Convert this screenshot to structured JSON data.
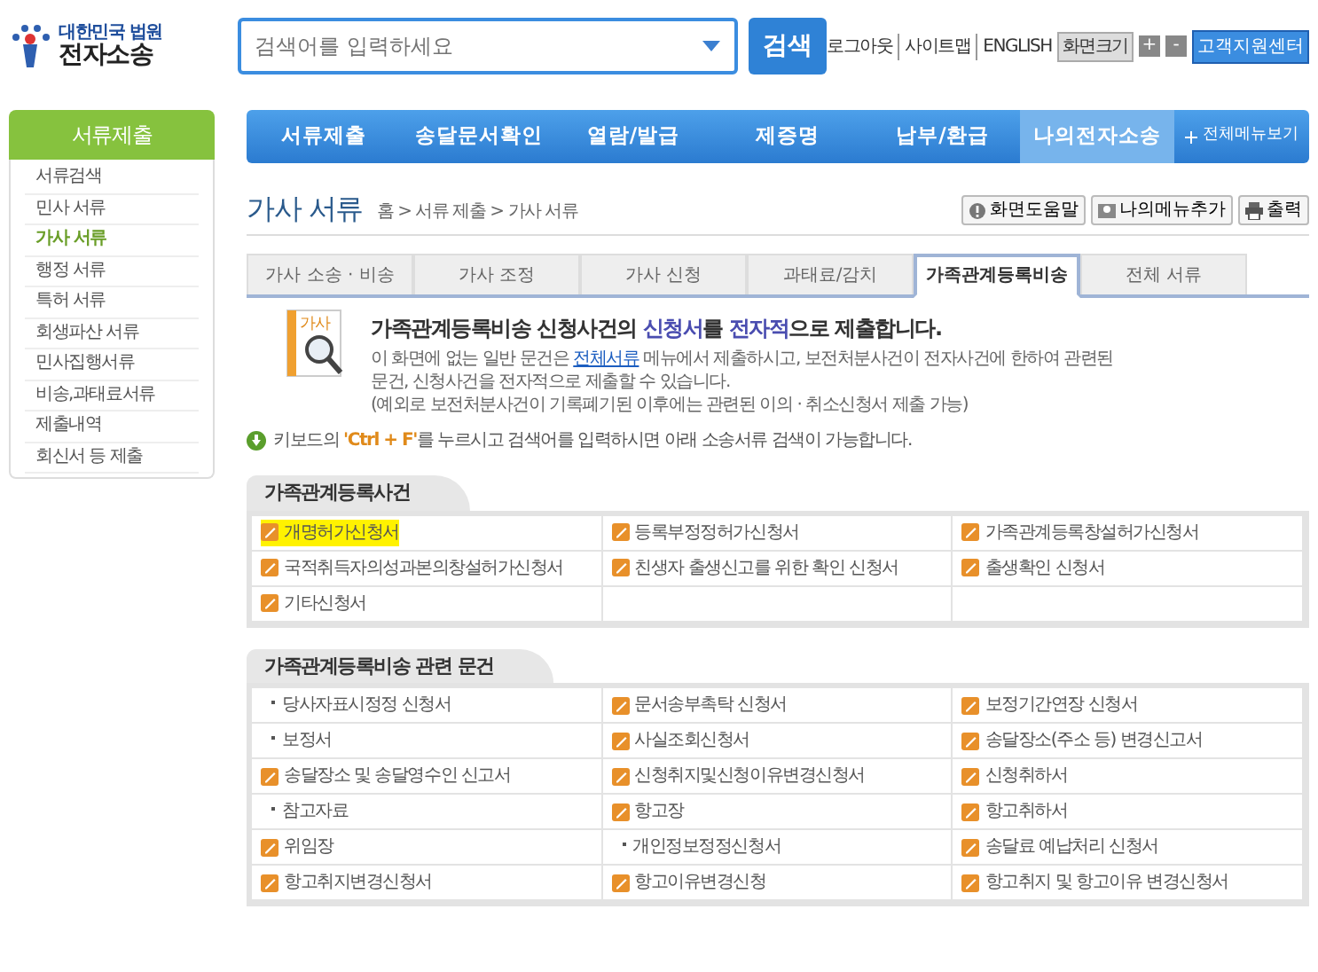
{
  "logo": {
    "subtitle": "대한민국 법원",
    "title": "전자소송"
  },
  "search": {
    "placeholder": "검색어를 입력하세요",
    "button": "검색"
  },
  "top_links": [
    "로그아웃",
    "사이트맵",
    "ENGLISH"
  ],
  "screen_size": {
    "label": "화면크기",
    "buttons": [
      "+",
      "-"
    ]
  },
  "support_button": "고객지원센터",
  "nav": [
    {
      "label": "서류제출",
      "selected": false
    },
    {
      "label": "송달문서확인",
      "selected": false
    },
    {
      "label": "열람/발급",
      "selected": false
    },
    {
      "label": "제증명",
      "selected": false
    },
    {
      "label": "납부/환급",
      "selected": false
    },
    {
      "label": "나의전자소송",
      "selected": true
    }
  ],
  "all_menu": "전체메뉴보기",
  "sidebar": {
    "title": "서류제출",
    "items": [
      {
        "label": "서류검색",
        "selected": false
      },
      {
        "label": "민사 서류",
        "selected": false
      },
      {
        "label": "가사 서류",
        "selected": true
      },
      {
        "label": "행정 서류",
        "selected": false
      },
      {
        "label": "특허 서류",
        "selected": false
      },
      {
        "label": "회생파산 서류",
        "selected": false
      },
      {
        "label": "민사집행서류",
        "selected": false
      },
      {
        "label": "비송,과태료서류",
        "selected": false
      },
      {
        "label": "제출내역",
        "selected": false
      },
      {
        "label": "회신서 등 제출",
        "selected": false
      }
    ]
  },
  "page_title": "가사 서류",
  "breadcrumb": "홈 > 서류 제출 > 가사 서류",
  "tools": [
    {
      "kind": "help",
      "label": "화면도움말"
    },
    {
      "kind": "menu",
      "label": "나의메뉴추가"
    },
    {
      "kind": "print",
      "label": "출력"
    }
  ],
  "tabs": [
    {
      "label": "가사 소송 · 비송",
      "selected": false
    },
    {
      "label": "가사 조정",
      "selected": false
    },
    {
      "label": "가사 신청",
      "selected": false
    },
    {
      "label": "과태료/감치",
      "selected": false
    },
    {
      "label": "가족관계등록비송",
      "selected": true
    },
    {
      "label": "전체 서류",
      "selected": false
    }
  ],
  "intro": {
    "icon_label": "가사",
    "heading": [
      {
        "text": "가족관계등록비송 신청사건의 ",
        "emphasis": false
      },
      {
        "text": "신청서",
        "emphasis": true
      },
      {
        "text": "를 ",
        "emphasis": false
      },
      {
        "text": "전자적",
        "emphasis": true
      },
      {
        "text": "으로 제출합니다.",
        "emphasis": false
      }
    ],
    "body": [
      {
        "text": "이 화면에 없는 일반 문건은 ",
        "link": false
      },
      {
        "text": "전체서류",
        "link": true
      },
      {
        "text": " 메뉴에서 제출하시고, 보전처분사건이 전자사건에 한하여 관련된 문건, 신청사건을 전자적으로 제출할 수 있습니다.",
        "link": false
      }
    ],
    "note": "(예외로 보전처분사건이 기록폐기된 이후에는 관련된 이의 · 취소신청서 제출 가능)"
  },
  "hint": [
    {
      "text": "키보드의 ",
      "emphasis": false
    },
    {
      "text": "'Ctrl + F'",
      "emphasis": true
    },
    {
      "text": "를 누르시고 검색어를 입력하시면 아래 소송서류 검색이 가능합니다.",
      "emphasis": false
    }
  ],
  "sections": [
    {
      "title": "가족관계등록사건",
      "items": [
        {
          "label": "개명허가신청서",
          "kind": "doc",
          "highlighted": true
        },
        {
          "label": "등록부정정허가신청서",
          "kind": "doc",
          "highlighted": false
        },
        {
          "label": "가족관계등록창설허가신청서",
          "kind": "doc",
          "highlighted": false
        },
        {
          "label": "국적취득자의성과본의창설허가신청서",
          "kind": "doc",
          "highlighted": false
        },
        {
          "label": "친생자 출생신고를 위한 확인 신청서",
          "kind": "doc",
          "highlighted": false
        },
        {
          "label": "출생확인 신청서",
          "kind": "doc",
          "highlighted": false
        },
        {
          "label": "기타신청서",
          "kind": "doc",
          "highlighted": false
        }
      ]
    },
    {
      "title": "가족관계등록비송 관련 문건",
      "items": [
        {
          "label": "당사자표시정정 신청서",
          "kind": "bullet",
          "highlighted": false
        },
        {
          "label": "문서송부촉탁 신청서",
          "kind": "doc",
          "highlighted": false
        },
        {
          "label": "보정기간연장 신청서",
          "kind": "doc",
          "highlighted": false
        },
        {
          "label": "보정서",
          "kind": "bullet",
          "highlighted": false
        },
        {
          "label": "사실조회신청서",
          "kind": "doc",
          "highlighted": false
        },
        {
          "label": "송달장소(주소 등) 변경신고서",
          "kind": "doc",
          "highlighted": false
        },
        {
          "label": "송달장소 및 송달영수인 신고서",
          "kind": "doc",
          "highlighted": false
        },
        {
          "label": "신청취지및신청이유변경신청서",
          "kind": "doc",
          "highlighted": false
        },
        {
          "label": "신청취하서",
          "kind": "doc",
          "highlighted": false
        },
        {
          "label": "참고자료",
          "kind": "bullet",
          "highlighted": false
        },
        {
          "label": "항고장",
          "kind": "doc",
          "highlighted": false
        },
        {
          "label": "항고취하서",
          "kind": "doc",
          "highlighted": false
        },
        {
          "label": "위임장",
          "kind": "doc",
          "highlighted": false
        },
        {
          "label": "개인정보정정신청서",
          "kind": "bullet",
          "highlighted": false
        },
        {
          "label": "송달료 예납처리 신청서",
          "kind": "doc",
          "highlighted": false
        },
        {
          "label": "항고취지변경신청서",
          "kind": "doc",
          "highlighted": false
        },
        {
          "label": "항고이유변경신청",
          "kind": "doc",
          "highlighted": false
        },
        {
          "label": "항고취지 및 항고이유 변경신청서",
          "kind": "doc",
          "highlighted": false
        }
      ]
    }
  ]
}
